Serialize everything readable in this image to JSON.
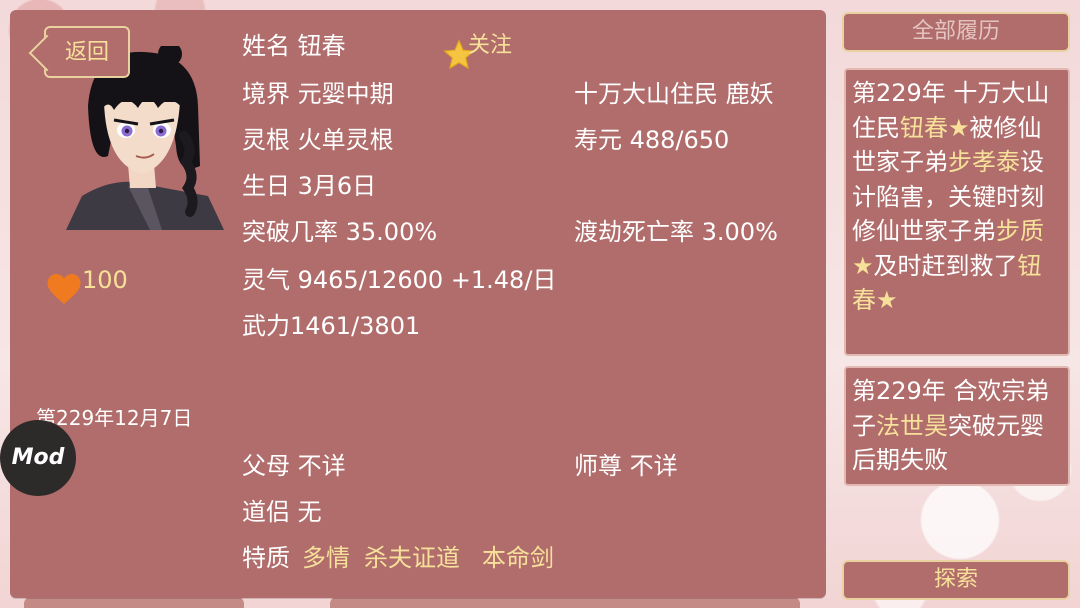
{
  "back_label": "返回",
  "follow_label": "关注",
  "profile": {
    "name_row": "姓名 钮春",
    "realm_row": "境界 元婴中期",
    "identity": "十万大山住民  鹿妖",
    "root_row": "灵根 火单灵根",
    "lifespan": "寿元 488/650",
    "birthday": "生日 3月6日",
    "breakthrough": "突破几率 35.00%",
    "tribulation": "渡劫死亡率 3.00%",
    "qi": "灵气 9465/12600 +1.48/日",
    "force": "武力1461/3801",
    "favor": "100",
    "date": "第229年12月7日",
    "parents": "父母 不详",
    "master": "师尊 不详",
    "partner": "道侣 无",
    "traits_label": "特质",
    "traits": [
      "多情",
      "杀夫证道",
      "本命剑"
    ]
  },
  "mod_label": "Mod",
  "history_button": "全部履历",
  "explore_button": "探索",
  "history": [
    [
      {
        "t": "第229年 十万大山住民",
        "h": false
      },
      {
        "t": "钮春★",
        "h": true
      },
      {
        "t": "被修仙世家子弟",
        "h": false
      },
      {
        "t": "步孝泰",
        "h": true
      },
      {
        "t": "设计陷害，关键时刻修仙世家子弟",
        "h": false
      },
      {
        "t": "步质★",
        "h": true
      },
      {
        "t": "及时赶到救了",
        "h": false
      },
      {
        "t": "钮春★",
        "h": true
      }
    ],
    [
      {
        "t": "第229年 合欢宗弟子",
        "h": false
      },
      {
        "t": "法世昊",
        "h": true
      },
      {
        "t": "突破元婴后期失败",
        "h": false
      }
    ]
  ],
  "colors": {
    "panel": "#b06d6c",
    "highlight": "#f7e19a",
    "border": "#ead2a0",
    "background": "#f4dede",
    "heart": "#f07a1f",
    "star": "#f5c542"
  },
  "icons": [
    "star-icon",
    "heart-icon"
  ]
}
